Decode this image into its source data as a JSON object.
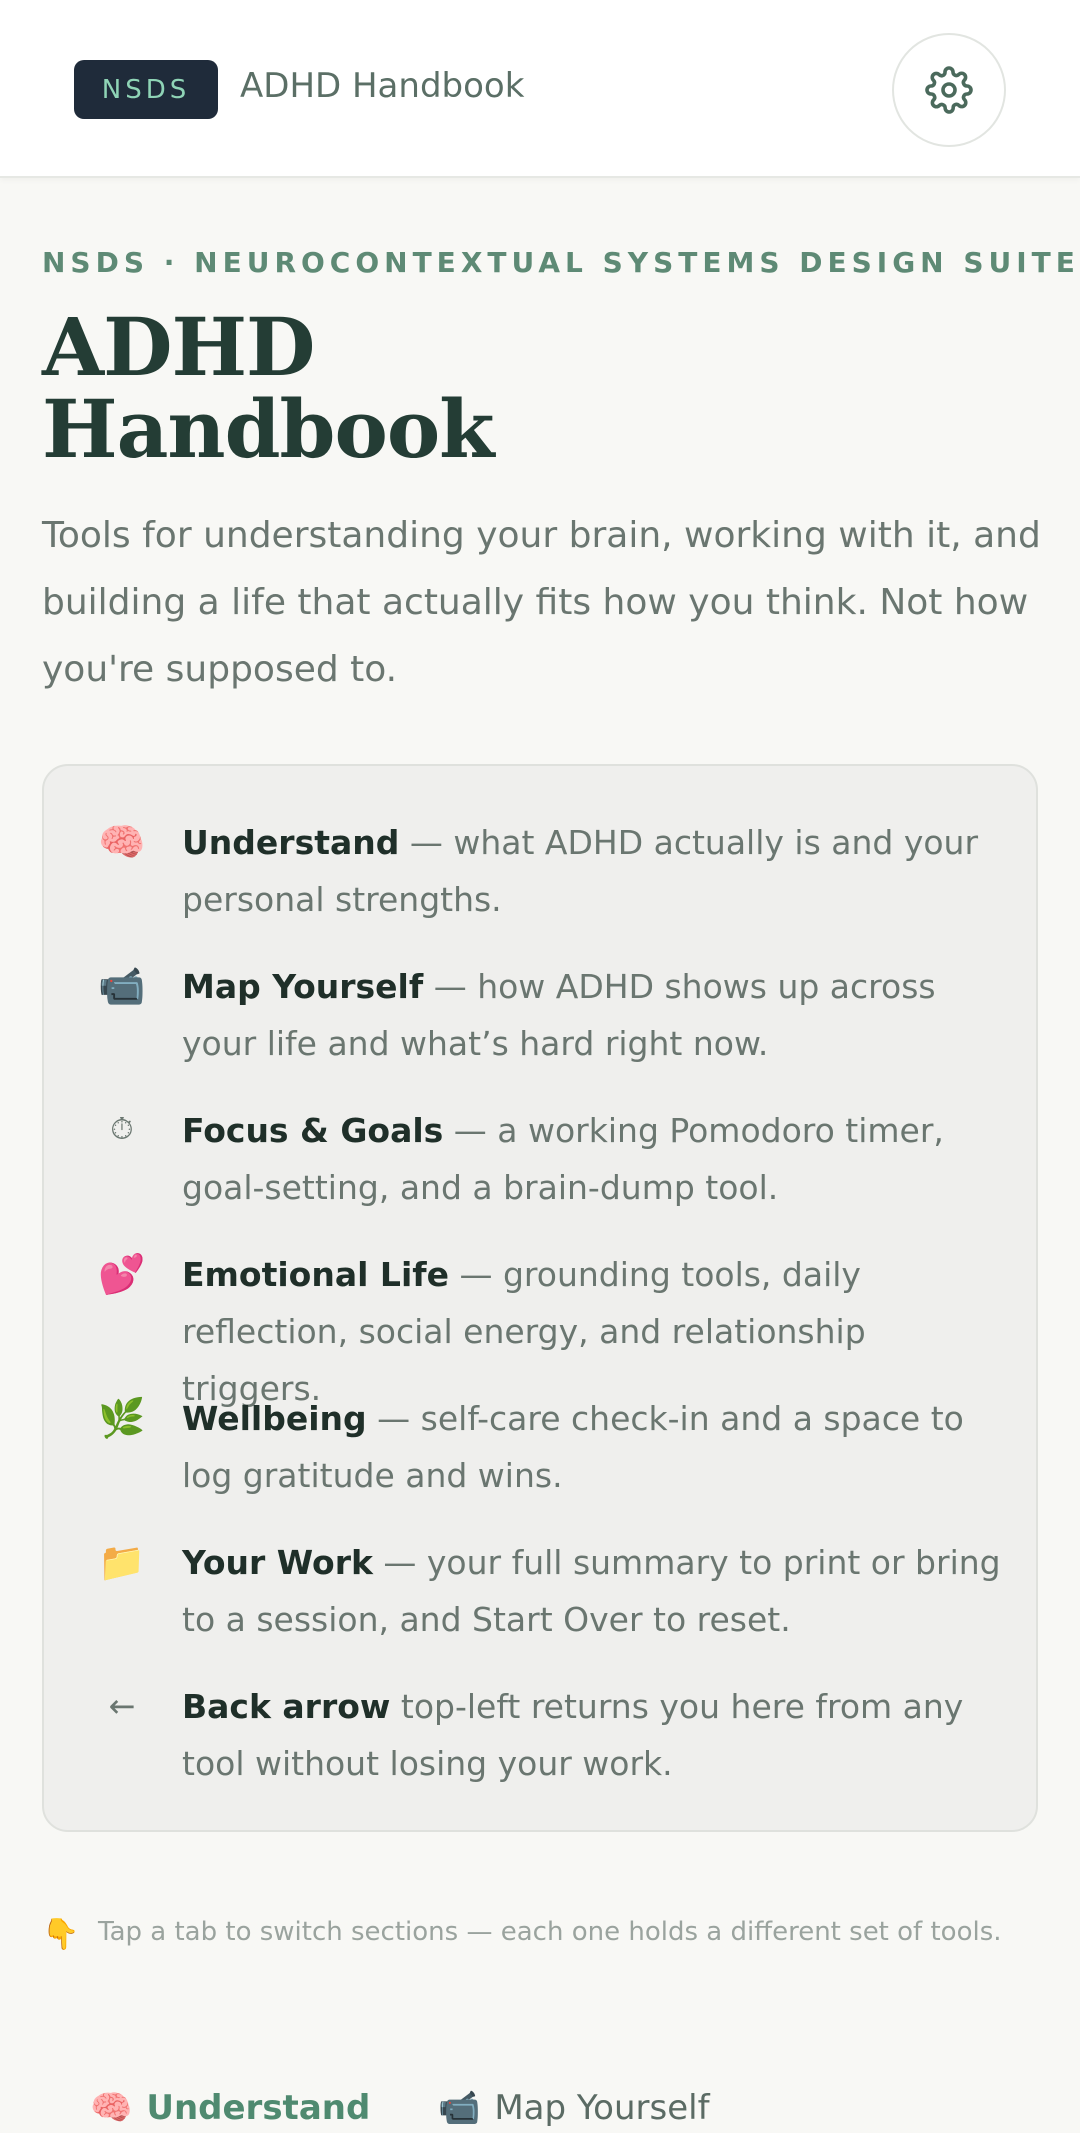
{
  "header": {
    "badge": "NSDS",
    "title": "ADHD Handbook",
    "settings_icon": "gear-icon"
  },
  "hero": {
    "kicker": "NSDS · NEUROCONTEXTUAL SYSTEMS DESIGN SUITE",
    "title_line1": "ADHD",
    "title_line2": "Handbook",
    "subtitle": "Tools for understanding your brain, working with it, and building a life that actually fits how you think. Not how you're supposed to."
  },
  "overview": {
    "items": [
      {
        "icon": "🧠",
        "icon_name": "brain-icon",
        "label": "Understand",
        "desc": " — what ADHD actually is and your personal strengths."
      },
      {
        "icon": "📹",
        "icon_name": "video-camera-icon",
        "label": "Map Yourself",
        "desc": " — how ADHD shows up across your life and what’s hard right now."
      },
      {
        "icon": "⏱",
        "icon_name": "stopwatch-icon",
        "label": "Focus & Goals",
        "desc": " — a working Pomodoro timer, goal-setting, and a brain-dump tool."
      },
      {
        "icon": "💕",
        "icon_name": "hearts-icon",
        "label": "Emotional Life",
        "desc": " — grounding tools, daily reflection, social energy, and relationship triggers."
      },
      {
        "icon": "🌿",
        "icon_name": "herb-icon",
        "label": "Wellbeing",
        "desc": " — self-care check-in and a space to log gratitude and wins."
      },
      {
        "icon": "📁",
        "icon_name": "folder-icon",
        "label": "Your Work",
        "desc": " — your full summary to print or bring to a session, and Start Over to reset."
      },
      {
        "icon": "←",
        "icon_name": "back-arrow-icon",
        "label": "Back arrow",
        "desc": " top-left returns you here from any tool without losing your work."
      }
    ]
  },
  "hint": {
    "icon": "👇",
    "text": "Tap a tab to switch sections — each one holds a different set of tools."
  },
  "tabs": [
    {
      "icon": "🧠",
      "label": "Understand",
      "active": true
    },
    {
      "icon": "📹",
      "label": "Map Yourself",
      "active": false
    }
  ],
  "colors": {
    "accent": "#5e8a75",
    "badge_bg": "#1f2b3a",
    "badge_text": "#8fd4b6",
    "title": "#243d35"
  }
}
